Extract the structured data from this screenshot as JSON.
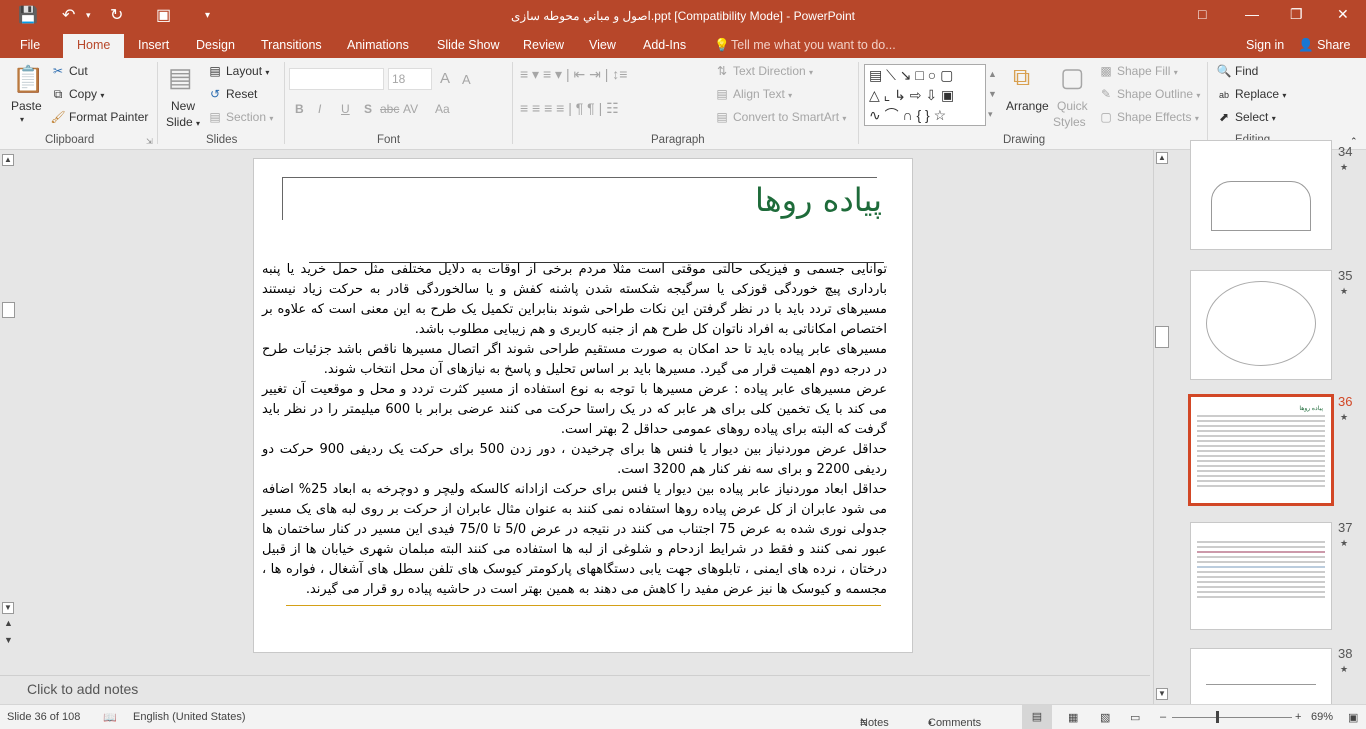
{
  "window": {
    "title": "اصول و مباني محوطه سازی.ppt [Compatibility Mode] - PowerPoint",
    "sign_in": "Sign in",
    "share": "Share"
  },
  "tabs": [
    "File",
    "Home",
    "Insert",
    "Design",
    "Transitions",
    "Animations",
    "Slide Show",
    "Review",
    "View",
    "Add-Ins"
  ],
  "tell_me": "Tell me what you want to do...",
  "ribbon": {
    "clipboard": {
      "paste": "Paste",
      "cut": "Cut",
      "copy": "Copy",
      "format_painter": "Format Painter",
      "label": "Clipboard"
    },
    "slides": {
      "new_slide": "New",
      "new_slide2": "Slide",
      "layout": "Layout",
      "reset": "Reset",
      "section": "Section",
      "label": "Slides"
    },
    "font": {
      "name": "",
      "size": "18",
      "label": "Font",
      "bold": "B",
      "italic": "I",
      "underline": "U",
      "shadow": "S",
      "strike": "abc",
      "spacing": "AV",
      "case": "Aa",
      "grow": "A",
      "shrink": "A"
    },
    "paragraph": {
      "text_direction": "Text Direction",
      "align_text": "Align Text",
      "convert_smartart": "Convert to SmartArt",
      "label": "Paragraph"
    },
    "drawing": {
      "arrange": "Arrange",
      "quick_styles": "Quick",
      "quick_styles2": "Styles",
      "shape_fill": "Shape Fill",
      "shape_outline": "Shape Outline",
      "shape_effects": "Shape Effects",
      "label": "Drawing"
    },
    "editing": {
      "find": "Find",
      "replace": "Replace",
      "select": "Select",
      "label": "Editing"
    }
  },
  "slide": {
    "title": "پیاده روها",
    "paragraphs": [
      "توانایی جسمی و فیزیکی حالتی موقتی است مثلا مردم برخی از اوقات به دلایل مختلفی مثل حمل خرید یا پنبه بارداری پیچ خوردگی قوزکی یا سرگیجه شکسته شدن پاشنه کفش و یا سالخوردگی قادر به حرکت زیاد نیستند مسیرهای تردد باید با در نظر گرفتن این نکات طراحی شوند بنابراین تکمیل یک طرح به این معنی است که علاوه بر اختصاص امکاناتی به افراد ناتوان کل طرح هم از جنبه کاربری و هم زیبایی مطلوب باشد.",
      "مسیرهای عابر پیاده باید تا حد امکان به صورت مستقیم طراحی شوند اگر اتصال مسیرها ناقص باشد جزئیات طرح در درجه دوم اهمیت قرار می گیرد. مسیرها باید بر اساس تحلیل و پاسخ به نیازهای آن محل انتخاب شوند.",
      "عرض مسیرهای عابر پیاده : عرض مسیرها با توجه به نوع استفاده از مسیر کثرت تردد و محل و موقعیت آن تغییر می کند با یک تخمین کلی برای هر عابر که در یک راستا حرکت می کنند عرضی برابر با 600 میلیمتر را در نظر باید گرفت که البته برای پیاده روهای عمومی حداقل 2 بهتر است.",
      "حداقل عرض موردنیاز بین دیوار یا فنس ها برای چرخیدن ، دور زدن 500 برای حرکت یک ردیفی 900 حرکت دو ردیفی 2200 و برای سه نفر کنار هم 3200 است.",
      "حداقل ابعاد موردنیاز عابر پیاده بین دیوار یا فنس برای حرکت ازادانه کالسکه ولیچر و دوچرخه به ابعاد 25% اضافه می شود عابران از کل عرض پیاده روها استفاده نمی کنند به عنوان مثال عابران از حرکت بر روی لبه های یک مسیر جدولی نوری شده به عرض 75 اجتناب می کنند در نتیجه در عرض 5/0 تا 75/0 فیدی این مسیر در کنار ساختمان ها عبور نمی کنند و فقط در شرایط ازدحام و شلوغی از لبه ها استفاده می کنند البته مبلمان شهری خیابان ها از قبیل درختان ، نرده های ایمنی ، تابلوهای جهت یابی دستگاههای پارکومتر کیوسک های تلفن سطل های آشغال ، فواره ها ، مجسمه و کیوسک ها نیز عرض مفید را کاهش می دهند به همین بهتر است در حاشیه پیاده رو قرار می گیرند."
    ]
  },
  "notes_placeholder": "Click to add notes",
  "thumbnails": [
    {
      "num": "34"
    },
    {
      "num": "35"
    },
    {
      "num": "36",
      "selected": true,
      "title": "پیاده روها"
    },
    {
      "num": "37"
    },
    {
      "num": "38"
    }
  ],
  "status": {
    "slide": "Slide 36 of 108",
    "language": "English (United States)",
    "notes": "Notes",
    "comments": "Comments",
    "zoom": "69%",
    "zoom_percent": 69
  },
  "colors": {
    "accent": "#b7472a",
    "selected": "#d24726",
    "slide_title": "#1e6b3a",
    "rule": "#d4a017"
  }
}
